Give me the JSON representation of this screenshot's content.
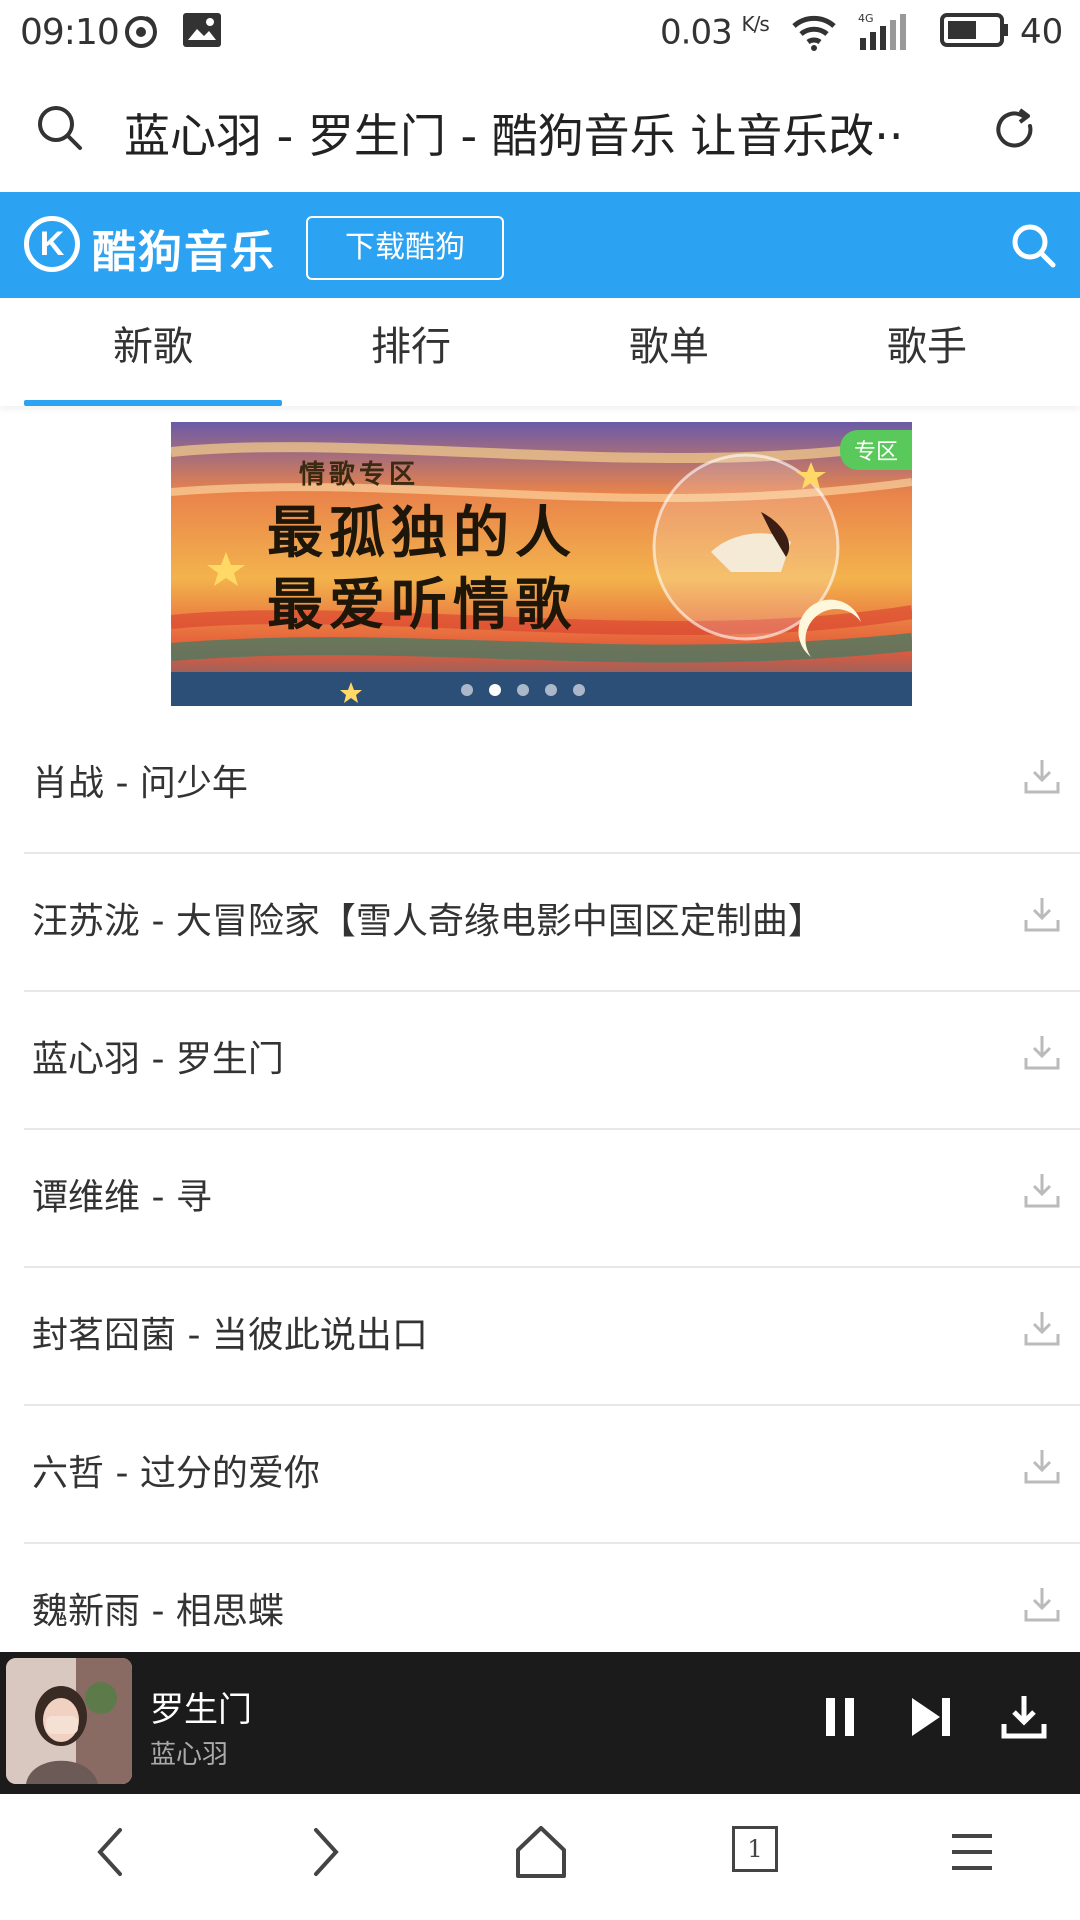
{
  "status_bar": {
    "time": "09:10",
    "speed": "0.03",
    "speed_unit": "K/s",
    "network": "4G",
    "battery": "40"
  },
  "browser": {
    "page_title": "蓝心羽 - 罗生门 - 酷狗音乐 让音乐改··",
    "search_icon": "search-icon",
    "refresh_icon": "refresh-icon"
  },
  "kugou": {
    "logo_letter": "K",
    "logo_text": "酷狗音乐",
    "download_button": "下载酷狗",
    "brand_color": "#2ca2f3"
  },
  "tabs": [
    {
      "label": "新歌",
      "active": true
    },
    {
      "label": "排行",
      "active": false
    },
    {
      "label": "歌单",
      "active": false
    },
    {
      "label": "歌手",
      "active": false
    }
  ],
  "banner": {
    "tag": "专区",
    "subtitle": "情歌专区",
    "line1": "最孤独的人",
    "line2": "最爱听情歌",
    "active_dot": 2,
    "dot_count": 5
  },
  "songs": [
    "肖战 - 问少年",
    "汪苏泷 - 大冒险家【雪人奇缘电影中国区定制曲】",
    "蓝心羽 - 罗生门",
    "谭维维 - 寻",
    "封茗囧菌 - 当彼此说出口",
    "六哲 - 过分的爱你",
    "魏新雨 - 相思蝶"
  ],
  "player": {
    "title": "罗生门",
    "artist": "蓝心羽",
    "state": "playing"
  },
  "bottom_nav": {
    "tab_count": "1"
  }
}
